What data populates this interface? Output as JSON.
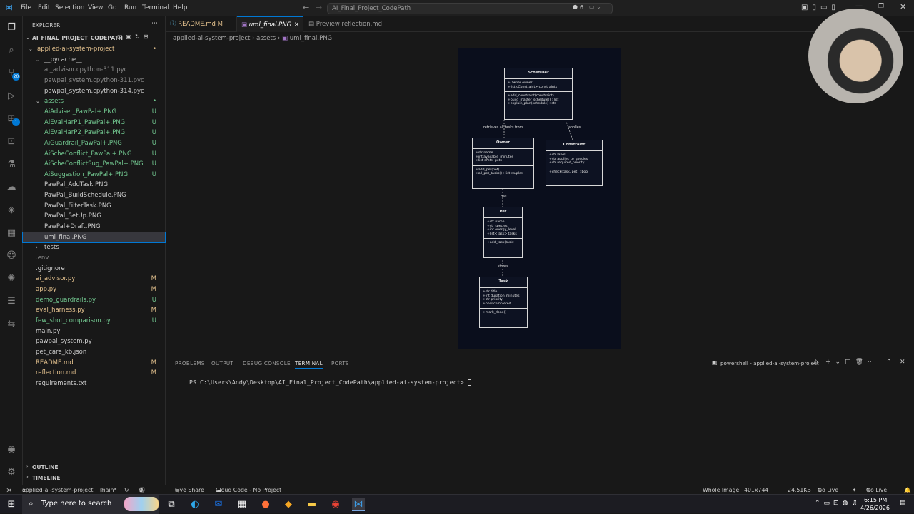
{
  "titlebar": {
    "menu": [
      "File",
      "Edit",
      "Selection",
      "View",
      "Go",
      "Run",
      "Terminal",
      "Help"
    ],
    "command_center": "AI_Final_Project_CodePath",
    "copilot_count": "6"
  },
  "activity": {
    "source_control_badge": "20",
    "extensions_badge": "1"
  },
  "explorer": {
    "title": "EXPLORER",
    "root": "AI_FINAL_PROJECT_CODEPATH",
    "rows": [
      {
        "label": "applied-ai-system-project",
        "indent": 1,
        "kind": "folder-open",
        "color": "orange",
        "status": "•"
      },
      {
        "label": "__pycache__",
        "indent": 2,
        "kind": "folder-open",
        "color": "normal",
        "status": ""
      },
      {
        "label": "ai_advisor.cpython-311.pyc",
        "indent": 3,
        "kind": "file",
        "color": "grey",
        "status": ""
      },
      {
        "label": "pawpal_system.cpython-311.pyc",
        "indent": 3,
        "kind": "file",
        "color": "grey",
        "status": ""
      },
      {
        "label": "pawpal_system.cpython-314.pyc",
        "indent": 3,
        "kind": "file",
        "color": "normal",
        "status": ""
      },
      {
        "label": "assets",
        "indent": 2,
        "kind": "folder-open",
        "color": "green",
        "status": "•"
      },
      {
        "label": "AiAdviser_PawPal+.PNG",
        "indent": 3,
        "kind": "file",
        "color": "green",
        "status": "U"
      },
      {
        "label": "AiEvalHarP1_PawPal+.PNG",
        "indent": 3,
        "kind": "file",
        "color": "green",
        "status": "U"
      },
      {
        "label": "AiEvalHarP2_PawPal+.PNG",
        "indent": 3,
        "kind": "file",
        "color": "green",
        "status": "U"
      },
      {
        "label": "AiGuardrail_PawPal+.PNG",
        "indent": 3,
        "kind": "file",
        "color": "green",
        "status": "U"
      },
      {
        "label": "AiScheConflict_PawPal+.PNG",
        "indent": 3,
        "kind": "file",
        "color": "green",
        "status": "U"
      },
      {
        "label": "AiScheConflictSug_PawPal+.PNG",
        "indent": 3,
        "kind": "file",
        "color": "green",
        "status": "U"
      },
      {
        "label": "AiSuggestion_PawPal+.PNG",
        "indent": 3,
        "kind": "file",
        "color": "green",
        "status": "U"
      },
      {
        "label": "PawPal_AddTask.PNG",
        "indent": 3,
        "kind": "file",
        "color": "normal",
        "status": ""
      },
      {
        "label": "PawPal_BuildSchedule.PNG",
        "indent": 3,
        "kind": "file",
        "color": "normal",
        "status": ""
      },
      {
        "label": "PawPal_FilterTask.PNG",
        "indent": 3,
        "kind": "file",
        "color": "normal",
        "status": ""
      },
      {
        "label": "PawPal_SetUp.PNG",
        "indent": 3,
        "kind": "file",
        "color": "normal",
        "status": ""
      },
      {
        "label": "PawPal+Draft.PNG",
        "indent": 3,
        "kind": "file",
        "color": "normal",
        "status": ""
      },
      {
        "label": "uml_final.PNG",
        "indent": 3,
        "kind": "file",
        "color": "normal",
        "status": "",
        "selected": true
      },
      {
        "label": "tests",
        "indent": 2,
        "kind": "folder-closed",
        "color": "normal",
        "status": ""
      },
      {
        "label": ".env",
        "indent": 2,
        "kind": "file",
        "color": "grey",
        "status": ""
      },
      {
        "label": ".gitignore",
        "indent": 2,
        "kind": "file",
        "color": "normal",
        "status": ""
      },
      {
        "label": "ai_advisor.py",
        "indent": 2,
        "kind": "file",
        "color": "orange",
        "status": "M"
      },
      {
        "label": "app.py",
        "indent": 2,
        "kind": "file",
        "color": "orange",
        "status": "M"
      },
      {
        "label": "demo_guardrails.py",
        "indent": 2,
        "kind": "file",
        "color": "green",
        "status": "U"
      },
      {
        "label": "eval_harness.py",
        "indent": 2,
        "kind": "file",
        "color": "orange",
        "status": "M"
      },
      {
        "label": "few_shot_comparison.py",
        "indent": 2,
        "kind": "file",
        "color": "green",
        "status": "U"
      },
      {
        "label": "main.py",
        "indent": 2,
        "kind": "file",
        "color": "normal",
        "status": ""
      },
      {
        "label": "pawpal_system.py",
        "indent": 2,
        "kind": "file",
        "color": "normal",
        "status": ""
      },
      {
        "label": "pet_care_kb.json",
        "indent": 2,
        "kind": "file",
        "color": "normal",
        "status": ""
      },
      {
        "label": "README.md",
        "indent": 2,
        "kind": "file",
        "color": "orange",
        "status": "M"
      },
      {
        "label": "reflection.md",
        "indent": 2,
        "kind": "file",
        "color": "orange",
        "status": "M"
      },
      {
        "label": "requirements.txt",
        "indent": 2,
        "kind": "file",
        "color": "normal",
        "status": ""
      }
    ],
    "outline": "OUTLINE",
    "timeline": "TIMELINE"
  },
  "tabs": [
    {
      "label": "README.md M",
      "active": false
    },
    {
      "label": "uml_final.PNG",
      "active": true
    },
    {
      "label": "Preview reflection.md",
      "active": false
    }
  ],
  "breadcrumbs": [
    "applied-ai-system-project",
    "assets",
    "uml_final.PNG"
  ],
  "uml": {
    "scheduler": {
      "title": "Scheduler",
      "attrs": [
        "+Owner owner",
        "+list<Constraint> constraints"
      ],
      "methods": [
        "+add_constraint(constraint)",
        "+build_master_schedule() : list",
        "+explain_plan(schedule) : str"
      ]
    },
    "owner": {
      "title": "Owner",
      "attrs": [
        "+str name",
        "+int available_minutes",
        "+list<Pet> pets"
      ],
      "methods": [
        "+add_pet(pet)",
        "+all_pet_tasks() : list<tuple>"
      ]
    },
    "constraint": {
      "title": "Constraint",
      "attrs": [
        "+str label",
        "+str applies_to_species",
        "+str required_priority"
      ],
      "methods": [
        "+check(task, pet) : bool"
      ]
    },
    "pet": {
      "title": "Pet",
      "attrs": [
        "+str name",
        "+str species",
        "+int energy_level",
        "+list<Task> tasks"
      ],
      "methods": [
        "+add_task(task)"
      ]
    },
    "task": {
      "title": "Task",
      "attrs": [
        "+str title",
        "+int duration_minutes",
        "+str priority",
        "+bool completed"
      ],
      "methods": [
        "+mark_done()"
      ]
    },
    "relations": {
      "retrieves": "retrieves all tasks from",
      "applies": "applies",
      "has": "has",
      "stores": "stores"
    }
  },
  "panel": {
    "tabs": [
      "PROBLEMS",
      "OUTPUT",
      "DEBUG CONSOLE",
      "TERMINAL",
      "PORTS"
    ],
    "active_tab": "TERMINAL",
    "terminal_name": "powershell - applied-ai-system-project",
    "prompt": "PS C:\\Users\\Andy\\Desktop\\AI_Final_Project_CodePath\\applied-ai-system-project> "
  },
  "status": {
    "remote": "applied-ai-system-project",
    "branch": "main*",
    "errors": "0",
    "warnings": "0",
    "live_share": "Live Share",
    "cloud_code": "Cloud Code - No Project",
    "image_mode": "Whole Image",
    "dimensions": "401x744",
    "size": "24.51KB",
    "go_live_1": "Go Live",
    "go_live_2": "Go Live"
  },
  "taskbar": {
    "search": "Type here to search",
    "time": "6:15 PM",
    "date": "4/26/2026"
  }
}
